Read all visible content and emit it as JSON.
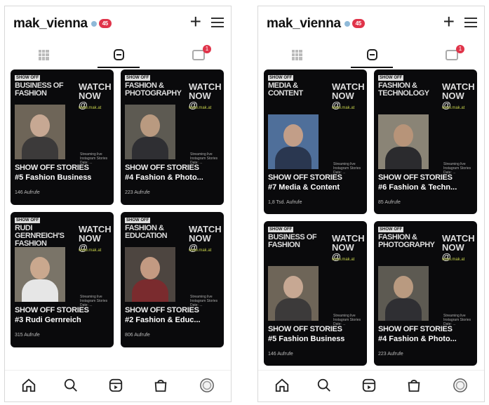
{
  "left": {
    "username": "mak_vienna",
    "badge": "45",
    "tab_badge": "1",
    "cards": [
      {
        "panel_title": "Business of Fashion",
        "episode": "#5 Fashion Business",
        "views": "146 Aufrufe"
      },
      {
        "panel_title": "Fashion & Photography",
        "episode": "#4 Fashion & Photo...",
        "views": "223 Aufrufe"
      },
      {
        "panel_title": "Rudi Gernreich's Fashion Forward",
        "episode": "#3 Rudi Gernreich",
        "views": "315 Aufrufe"
      },
      {
        "panel_title": "Fashion & Education",
        "episode": "#2 Fashion & Educ...",
        "views": "806 Aufrufe"
      }
    ]
  },
  "right": {
    "username": "mak_vienna",
    "badge": "45",
    "tab_badge": "1",
    "cards": [
      {
        "panel_title": "Media & Content",
        "episode": "#7 Media & Content",
        "views": "1,8 Tsd. Aufrufe"
      },
      {
        "panel_title": "Fashion & Technology",
        "episode": "#6 Fashion & Techn...",
        "views": "85 Aufrufe"
      },
      {
        "panel_title": "Business of Fashion",
        "episode": "#5 Fashion Business",
        "views": "146 Aufrufe"
      },
      {
        "panel_title": "Fashion & Photography",
        "episode": "#4 Fashion & Photo...",
        "views": "223 Aufrufe"
      }
    ]
  },
  "common": {
    "show_off": "SHOW OFF",
    "watch_now": "WATCH NOW @",
    "url": "www.mak.at",
    "series": "SHOW OFF STORIES",
    "small_print": "Streaming live Instagram Stories Date: ...",
    "plus": "+"
  }
}
